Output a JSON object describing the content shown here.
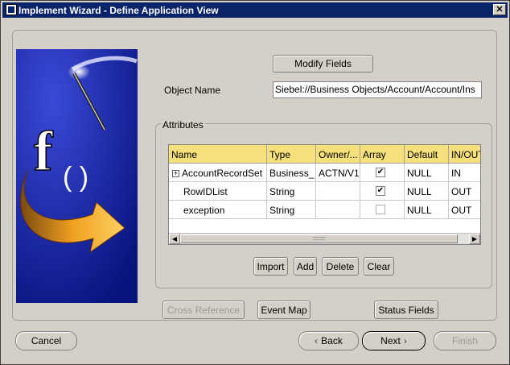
{
  "window": {
    "title": "Implement Wizard - Define Application View",
    "close_label": "✕"
  },
  "form": {
    "modify_fields_label": "Modify Fields",
    "object_name_label": "Object Name",
    "object_name_value": "Siebel://Business Objects/Account/Account/Ins"
  },
  "attributes": {
    "legend": "Attributes",
    "columns": [
      "Name",
      "Type",
      "Owner/...",
      "Array",
      "Default",
      "IN/OUT"
    ],
    "rows": [
      {
        "name": "AccountRecordSet",
        "type": "Business_",
        "owner": "ACTN/V1",
        "array": "☑",
        "default": "NULL",
        "inout": "IN",
        "expander": "+"
      },
      {
        "name": "RowIDList",
        "type": "String",
        "owner": "",
        "array": "☑",
        "default": "NULL",
        "inout": "OUT"
      },
      {
        "name": "exception",
        "type": "String",
        "owner": "",
        "array": "☐",
        "default": "NULL",
        "inout": "OUT"
      }
    ],
    "import_label": "Import",
    "add_label": "Add",
    "delete_label": "Delete",
    "clear_label": "Clear"
  },
  "actions": {
    "cross_reference_label": "Cross Reference",
    "event_map_label": "Event Map",
    "status_fields_label": "Status Fields"
  },
  "nav": {
    "cancel_label": "Cancel",
    "back_label": "Back",
    "next_label": "Next",
    "finish_label": "Finish"
  },
  "colors": {
    "titlebar": "#0a246a",
    "header": "#f5e07c",
    "banner": "#1a2aa8",
    "arrow": "#f0a020"
  }
}
